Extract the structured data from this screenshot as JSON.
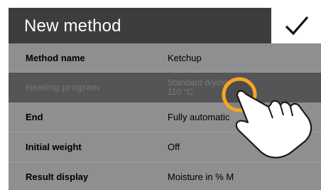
{
  "header": {
    "title": "New method",
    "confirm_icon": "checkmark-icon"
  },
  "rows": [
    {
      "label": "Method name",
      "value": "Ketchup"
    },
    {
      "label": "Heating program",
      "value_line1": "Standard drying",
      "value_line2": "110 °C"
    },
    {
      "label": "End",
      "value": "Fully automatic"
    },
    {
      "label": "Initial weight",
      "value": "Off"
    },
    {
      "label": "Result display",
      "value": "Moisture in % M"
    }
  ],
  "colors": {
    "header_bg": "#3d3c3e",
    "row_bg": "#8e8f91",
    "selected_row_bg": "#555457",
    "touch_ring": "#f5a623"
  },
  "overlay": {
    "icon": "tapping-hand-icon"
  }
}
